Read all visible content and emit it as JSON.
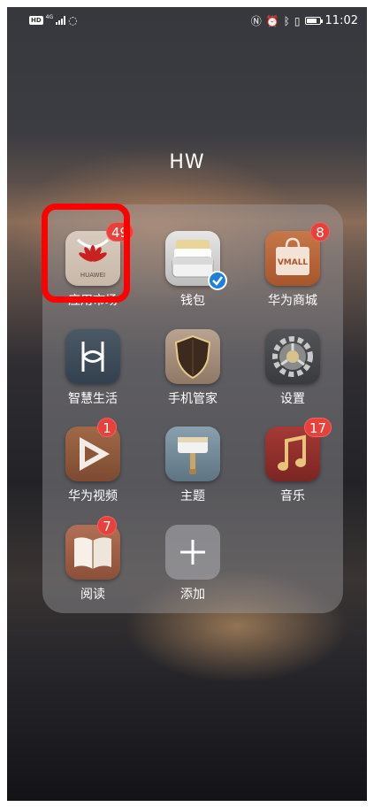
{
  "status_bar": {
    "left_badge": "HD",
    "network": "4G",
    "time": "11:02",
    "battery_level": 0.8
  },
  "folder": {
    "title": "HW",
    "apps": [
      {
        "label": "应用市场",
        "badge": "49",
        "icon": "huawei-appgallery-icon",
        "icon_text": "HUAWEI"
      },
      {
        "label": "钱包",
        "badge": "",
        "icon": "wallet-icon"
      },
      {
        "label": "华为商城",
        "badge": "8",
        "icon": "vmall-bag-icon",
        "icon_text": "VMALL"
      },
      {
        "label": "智慧生活",
        "badge": "",
        "icon": "smart-life-icon"
      },
      {
        "label": "手机管家",
        "badge": "",
        "icon": "shield-icon"
      },
      {
        "label": "设置",
        "badge": "",
        "icon": "gear-icon"
      },
      {
        "label": "华为视频",
        "badge": "1",
        "icon": "play-icon"
      },
      {
        "label": "主题",
        "badge": "",
        "icon": "paintbrush-icon"
      },
      {
        "label": "音乐",
        "badge": "17",
        "icon": "music-note-icon"
      },
      {
        "label": "阅读",
        "badge": "7",
        "icon": "open-book-icon"
      },
      {
        "label": "添加",
        "badge": "",
        "icon": "plus-icon"
      }
    ]
  },
  "colors": {
    "badge": "#e8403a",
    "highlight": "#ff0000"
  }
}
